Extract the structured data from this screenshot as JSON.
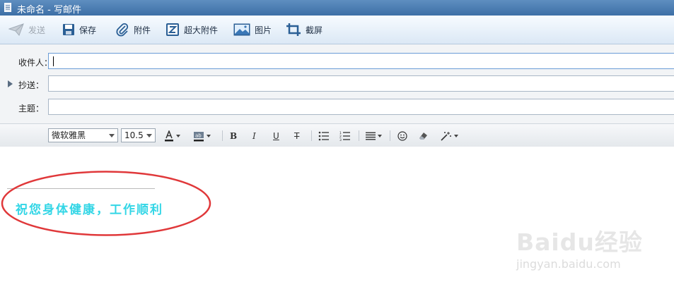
{
  "window": {
    "title": "未命名 - 写邮件"
  },
  "toolbar": {
    "send": "发送",
    "save": "保存",
    "attach": "附件",
    "big_attach": "超大附件",
    "image": "图片",
    "screenshot": "截屏"
  },
  "fields": {
    "to_label": "收件人：",
    "to_value": "",
    "cc_label": "抄送：",
    "cc_value": "",
    "subject_label": "主题：",
    "subject_value": ""
  },
  "format": {
    "font_family": "微软雅黑",
    "font_size": "10.5",
    "bold": "B",
    "italic": "I",
    "underline": "U",
    "strike": "T"
  },
  "body": {
    "signature": "祝您身体健康，工作顺利"
  },
  "watermark": {
    "logo_text": "Baidu经验",
    "url": "jingyan.baidu.com"
  },
  "colors": {
    "signature_text": "#33d6e6",
    "annotation_ellipse": "#e0383a"
  }
}
